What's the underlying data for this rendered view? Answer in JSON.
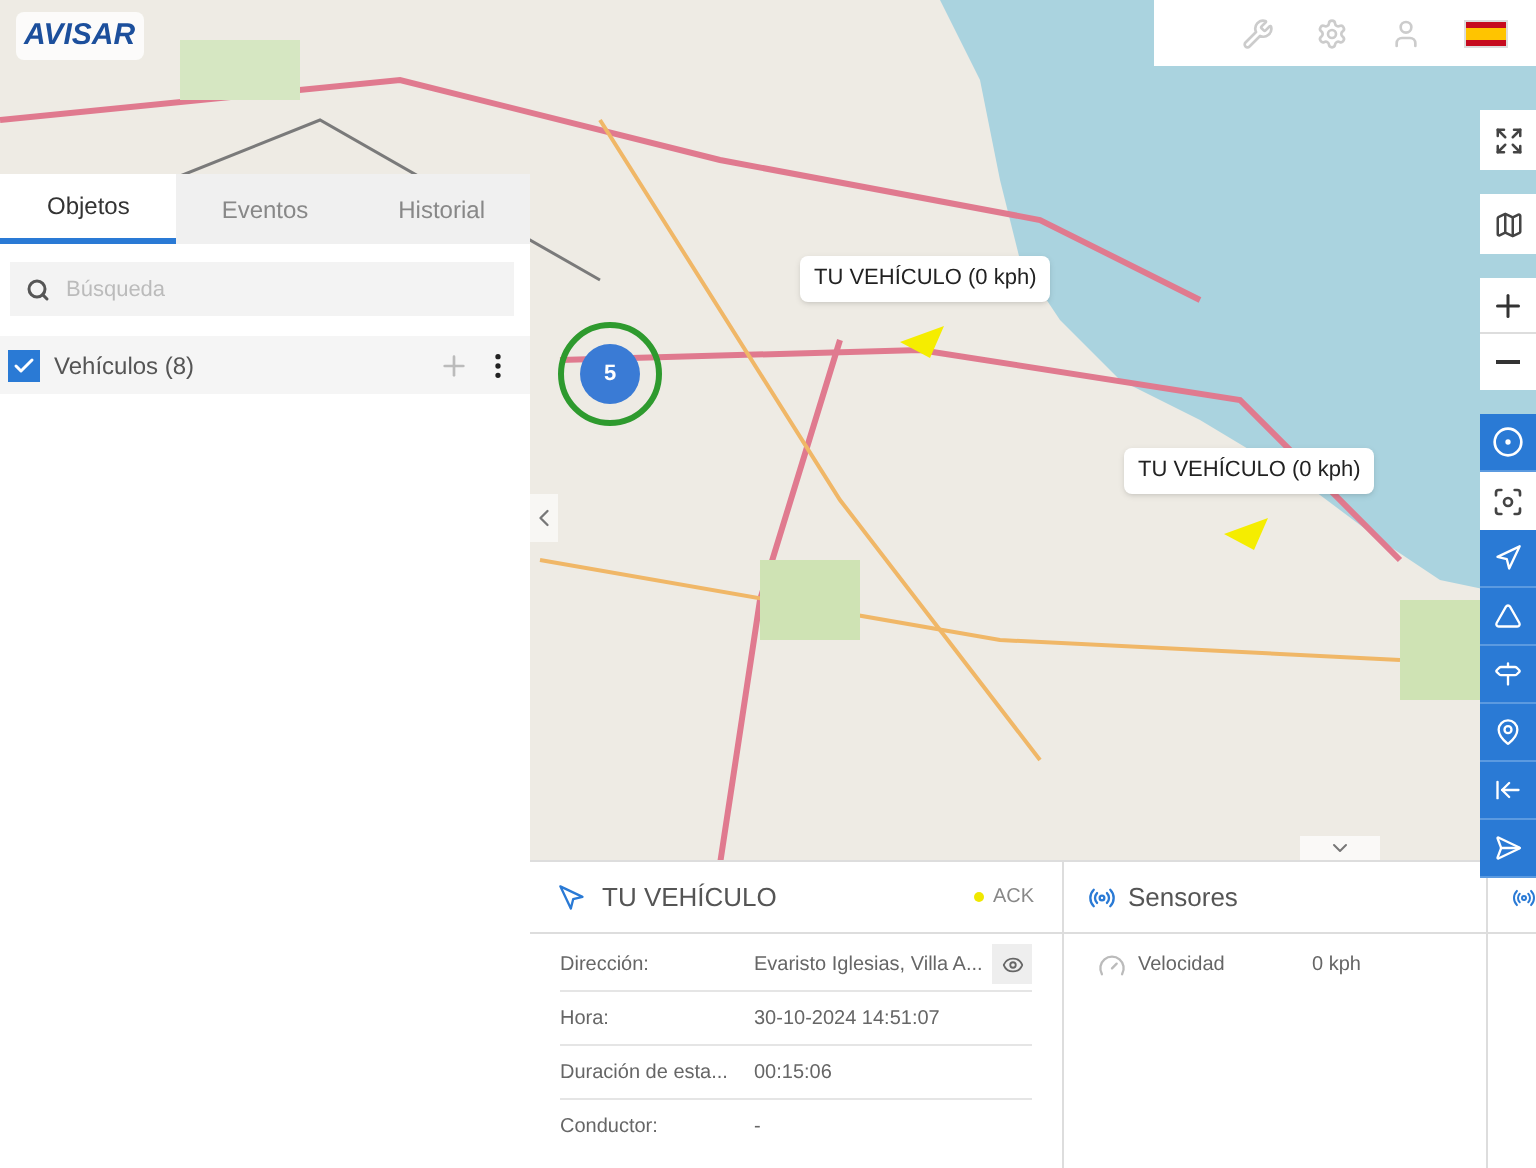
{
  "logo": {
    "text": "AVISAR"
  },
  "tabs": [
    {
      "label": "Objetos",
      "selected": true
    },
    {
      "label": "Eventos",
      "selected": false
    },
    {
      "label": "Historial",
      "selected": false
    }
  ],
  "search": {
    "placeholder": "Búsqueda"
  },
  "group": {
    "label": "Vehículos (8)",
    "checked": true
  },
  "map": {
    "cluster": {
      "count": "5"
    },
    "vehicles": [
      {
        "label": "TU VEHÍCULO (0 kph)"
      },
      {
        "label": "TU VEHÍCULO (0 kph)"
      }
    ]
  },
  "details": {
    "title": "TU VEHÍCULO",
    "status": "ACK",
    "rows": [
      {
        "label": "Dirección:",
        "value": "Evaristo Iglesias, Villa A...",
        "kind": "address"
      },
      {
        "label": "Hora:",
        "value": "30-10-2024 14:51:07",
        "kind": "text"
      },
      {
        "label": "Duración de esta...",
        "value": "00:15:06",
        "kind": "text"
      },
      {
        "label": "Conductor:",
        "value": "-",
        "kind": "text"
      }
    ]
  },
  "sensors": {
    "title": "Sensores",
    "rows": [
      {
        "name": "Velocidad",
        "value": "0 kph"
      }
    ]
  }
}
